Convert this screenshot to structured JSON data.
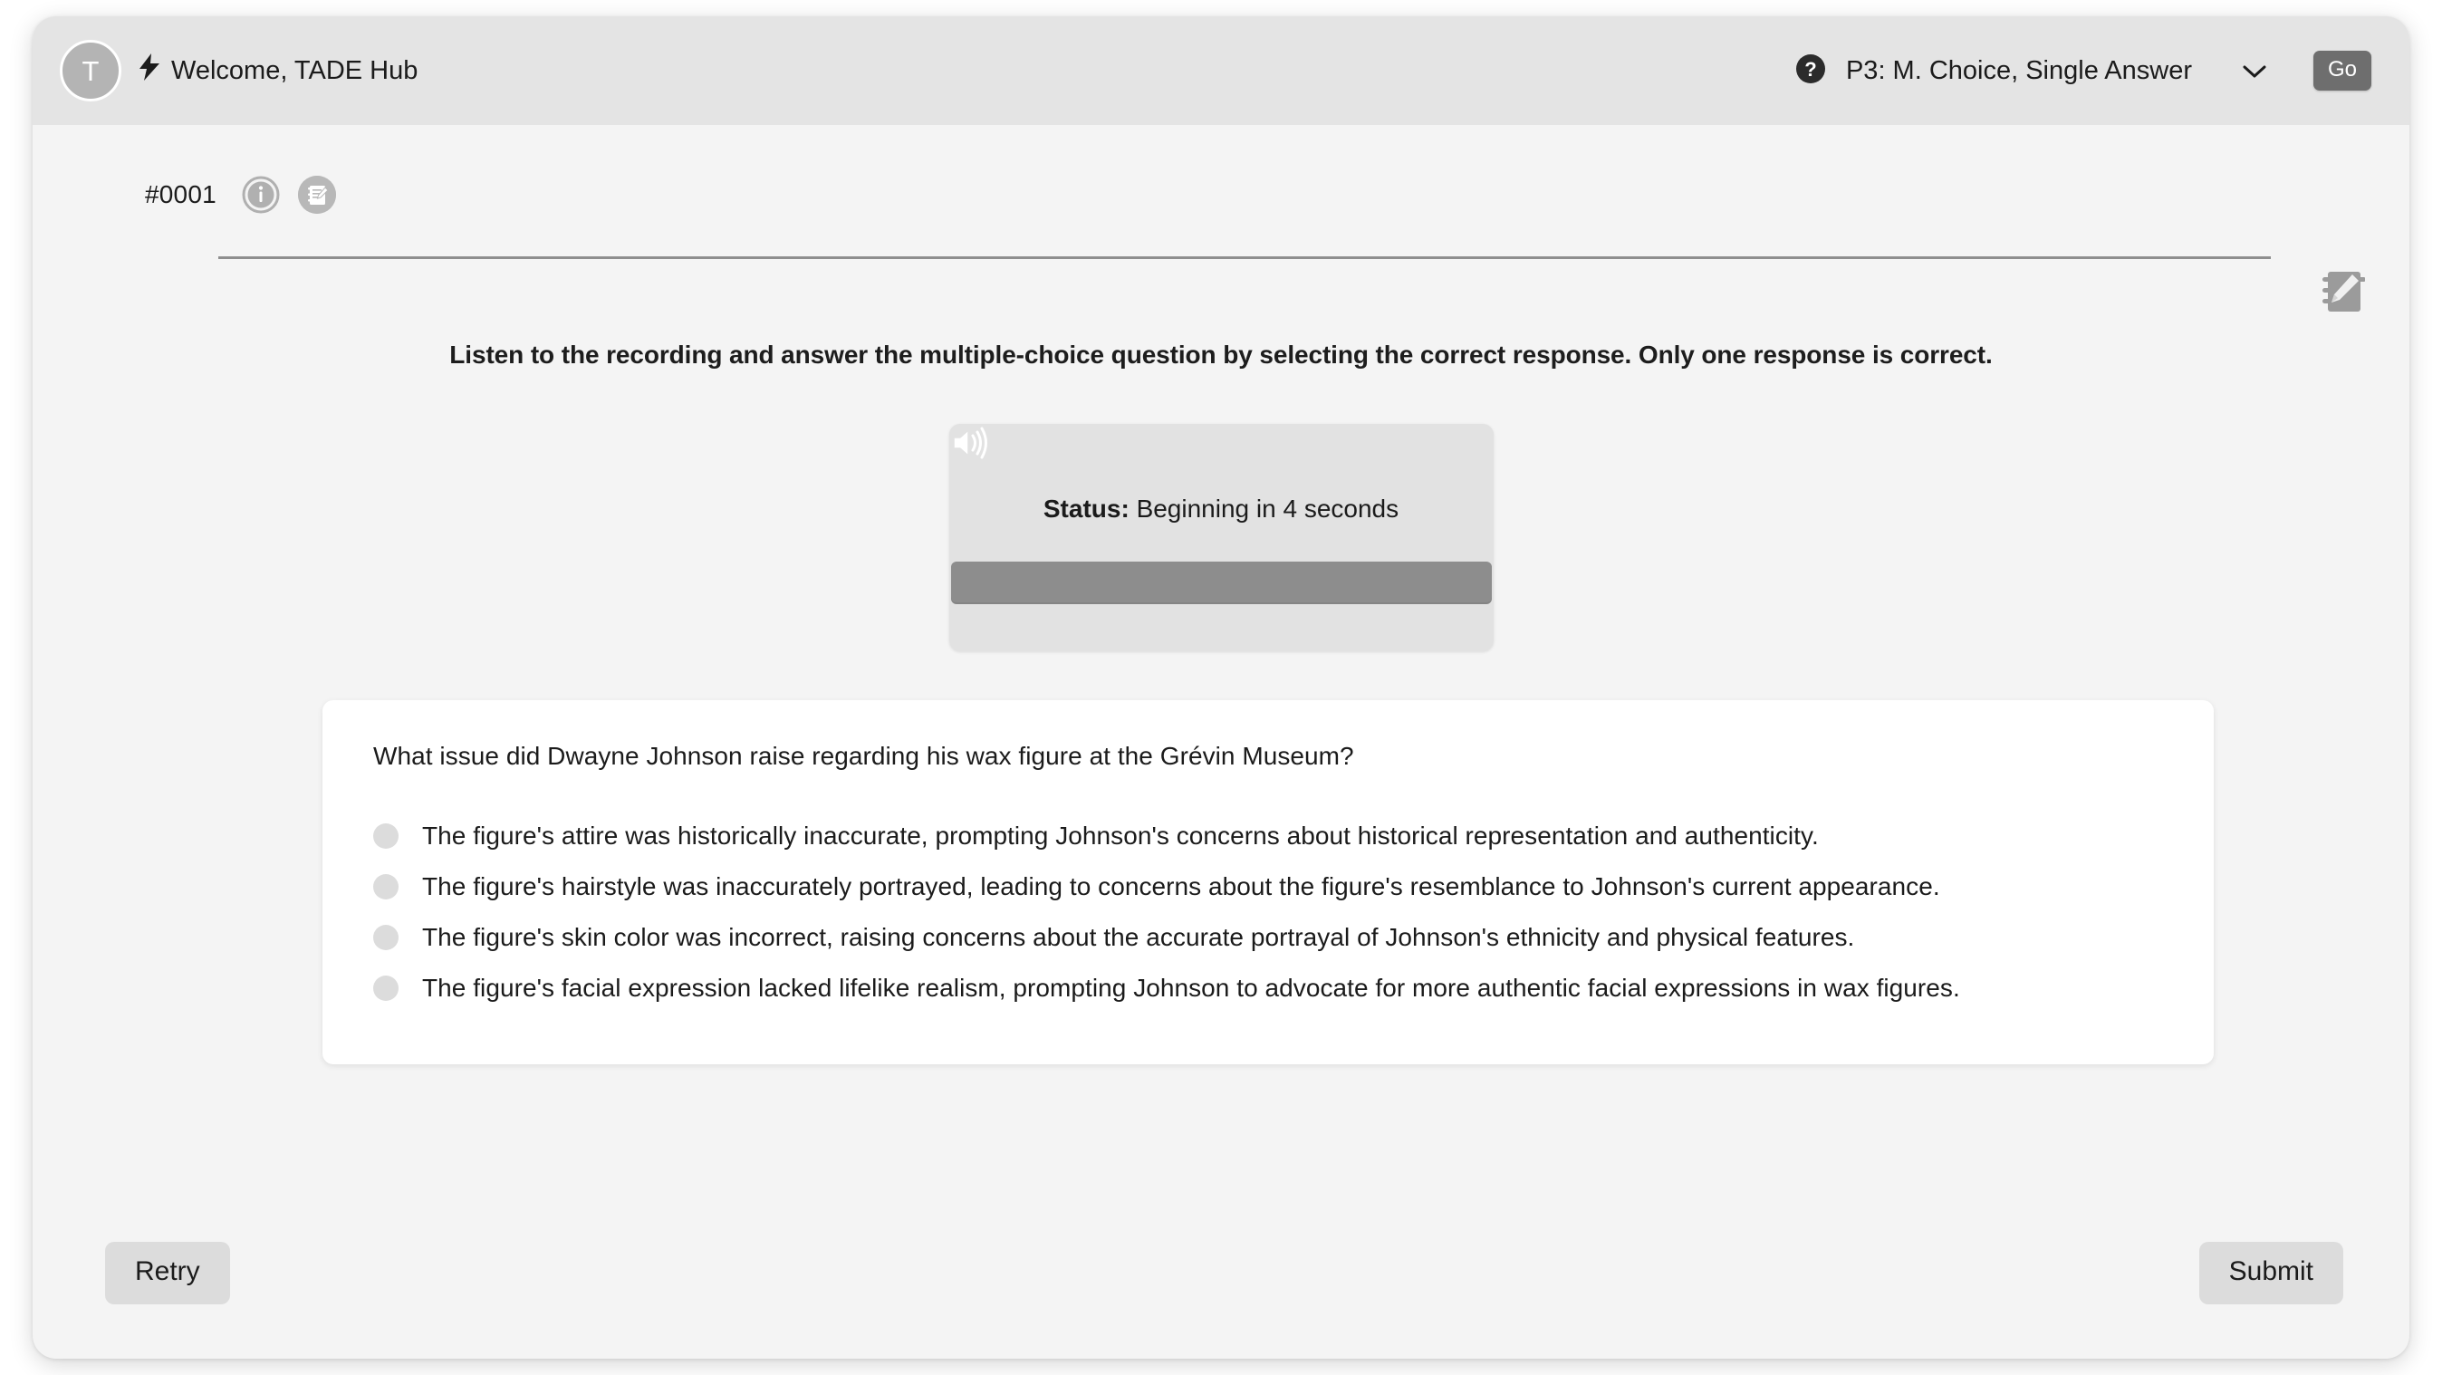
{
  "header": {
    "avatar_initial": "T",
    "bolt_icon": "bolt-icon",
    "welcome_text": "Welcome, TADE Hub",
    "help_icon": "help-circle-icon",
    "mode_value": "P3: M. Choice, Single Answer",
    "chevron_icon": "chevron-down-icon",
    "go_label": "Go"
  },
  "item": {
    "id": "#0001",
    "info_icon": "info-circle-icon",
    "note_icon": "note-edit-icon"
  },
  "notepad_fab": {
    "icon": "notepad-pencil-icon"
  },
  "instructions": "Listen to the recording and answer the multiple-choice question by selecting the correct response. Only one response is correct.",
  "audio": {
    "speaker_icon": "speaker-volume-icon",
    "status_label": "Status:",
    "status_value": "Beginning in 4 seconds",
    "progress_percent": 100
  },
  "question": {
    "prompt": "What issue did Dwayne Johnson raise regarding his wax figure at the Grévin Museum?",
    "options": [
      {
        "label": "The figure's attire was historically inaccurate, prompting Johnson's concerns about historical representation and authenticity.",
        "selected": false
      },
      {
        "label": "The figure's hairstyle was inaccurately portrayed, leading to concerns about the figure's resemblance to Johnson's current appearance.",
        "selected": false
      },
      {
        "label": "The figure's skin color was incorrect, raising concerns about the accurate portrayal of Johnson's ethnicity and physical features.",
        "selected": false
      },
      {
        "label": "The figure's facial expression lacked lifelike realism, prompting Johnson to advocate for more authentic facial expressions in wax figures.",
        "selected": false
      }
    ]
  },
  "footer": {
    "retry_label": "Retry",
    "submit_label": "Submit"
  },
  "colors": {
    "page_background": "#f4f4f4",
    "topbar_background": "#e4e4e4",
    "accent_dark": "#6e6e6e",
    "card_background": "#ffffff",
    "audio_card_background": "#e2e2e2",
    "audio_bar": "#8d8d8d",
    "radio_unselected": "#dcdcdc",
    "button_background": "#dcdcdc",
    "text_primary": "#1b1b1b"
  }
}
